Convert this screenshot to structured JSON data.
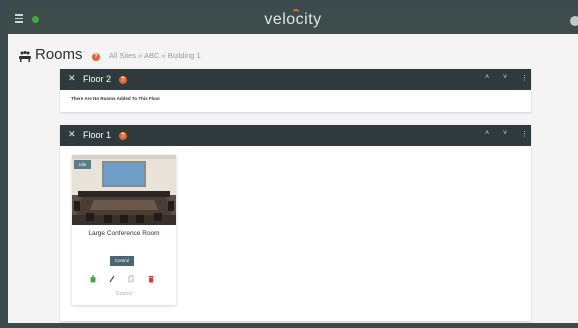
{
  "app": {
    "logo_text": "velocity"
  },
  "header": {
    "title": "Rooms",
    "breadcrumb": "All Sites » ABC » Building 1"
  },
  "floors": [
    {
      "name": "Floor 2",
      "empty_message": "There Are No Rooms Added To This Floor"
    },
    {
      "name": "Floor 1",
      "rooms": [
        {
          "name": "Large Conference Room",
          "status": "Idle",
          "control_label": "Control",
          "export_label": "Export"
        }
      ]
    }
  ],
  "icons": {
    "menu": "hamburger-menu-icon",
    "status": "status-dot-icon",
    "profile": "user-icon",
    "rooms": "conference-table-icon",
    "help": "question-mark-icon",
    "close": "close-icon",
    "collapse": "chevron-up-icon",
    "expand": "chevron-down-icon",
    "more": "kebab-menu-icon",
    "power": "power-icon",
    "edit": "pencil-icon",
    "copy": "copy-icon",
    "delete": "trash-icon"
  },
  "symbols": {
    "close": "✕",
    "chevron_up": "˄",
    "chevron_down": "˅",
    "more": "⋮",
    "help": "?"
  },
  "colors": {
    "topbar": "#3e4b4b",
    "panel_header": "#2e3a3b",
    "accent": "#e8632b",
    "status_green": "#3fae3f",
    "delete_red": "#e0393e",
    "control_button": "#4a6670"
  }
}
